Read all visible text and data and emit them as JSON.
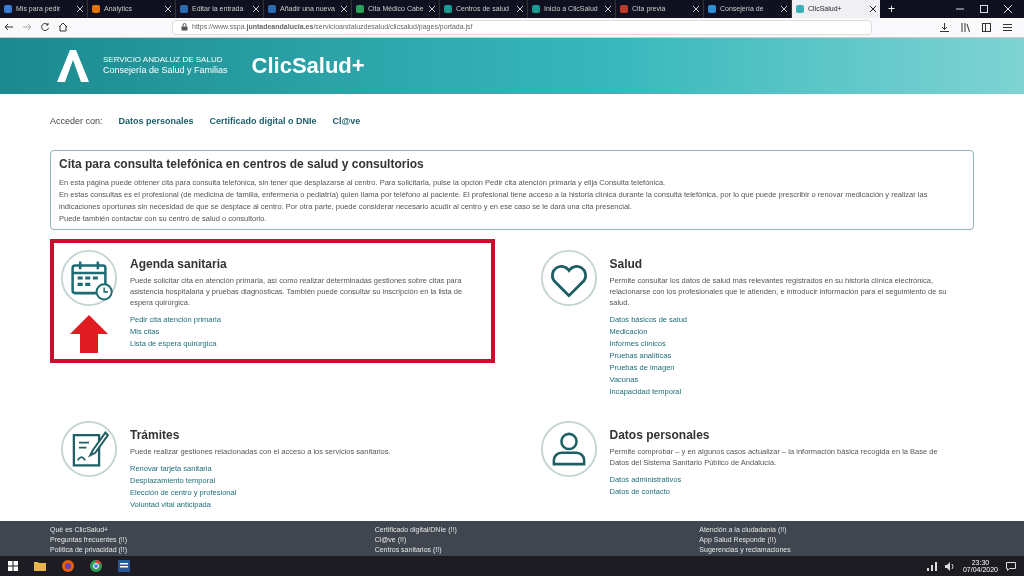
{
  "browser": {
    "tabs": [
      {
        "title": "Mis para pedir",
        "selected": false
      },
      {
        "title": "Analytics",
        "selected": false
      },
      {
        "title": "Editar la entrada",
        "selected": false
      },
      {
        "title": "Añadir una nueva",
        "selected": false
      },
      {
        "title": "Cita Médico Cabe",
        "selected": false
      },
      {
        "title": "Centros de salud",
        "selected": false
      },
      {
        "title": "Inicio a ClicSalud",
        "selected": false
      },
      {
        "title": "Cita previa",
        "selected": false
      },
      {
        "title": "Consejería de",
        "selected": false
      },
      {
        "title": "ClicSalud+",
        "selected": true
      }
    ],
    "new_tab": "+",
    "url": "https://www.sspa.**juntadeandalucia.es**/servicioandaluzdesalud/clicsalud/pages/portada.jsf"
  },
  "header": {
    "org_line_1": "SERVICIO ANDALUZ DE SALUD",
    "org_line_2": "Consejería de Salud y Familias",
    "brand": "ClicSalud+"
  },
  "access_bar": {
    "label": "Acceder con:",
    "options": [
      "Datos personales",
      "Certificado digital o DNIe",
      "Cl@ve"
    ]
  },
  "notice": {
    "title": "Cita para consulta telefónica en centros de salud y consultorios",
    "paragraphs": [
      "En esta página puede obtener cita para consulta telefónica, sin tener que desplazarse al centro. Para solicitarla, pulse la opción Pedir cita atención primaria y elija Consulta telefónica.",
      "En estas consultas es el profesional (de medicina de familia, enfermería o pediatría) quien llama por teléfono al paciente. El profesional tiene acceso a la historia clínica durante la consulta telefónica, por lo que puede prescribir o renovar medicación y realizar las indicaciones oportunas sin necesidad de que se desplace al centro. Por otra parte, puede considerar necesario acudir al centro y en ese caso se le dará una cita presencial.",
      "Puede también contactar con su centro de salud o consultorio."
    ]
  },
  "services": [
    {
      "kind": "calendar",
      "title": "Agenda sanitaria",
      "highlighted": true,
      "description": "Puede solicitar cita en atención primaria, así como realizar determinadas gestiones sobre citas para asistencia hospitalaria y pruebas diagnósticas. También puede consultar su inscripción en la lista de espera quirúrgica.",
      "links": [
        "Pedir cita atención primaria",
        "Mis citas",
        "Lista de espera quirúrgica"
      ]
    },
    {
      "kind": "heart",
      "title": "Salud",
      "highlighted": false,
      "description": "Permite consultar los datos de salud más relevantes registrados en su historia clínica electrónica, relacionarse con los profesionales que le atienden, e introducir información para el seguimiento de su salud.",
      "links": [
        "Datos básicos de salud",
        "Medicación",
        "Informes clínicos",
        "Pruebas analíticas",
        "Pruebas de imagen",
        "Vacunas",
        "Incapacidad temporal"
      ]
    },
    {
      "kind": "document",
      "title": "Trámites",
      "highlighted": false,
      "description": "Puede realizar gestiones relacionadas con el acceso a los servicios sanitarios.",
      "links": [
        "Renovar tarjeta sanitaria",
        "Desplazamiento temporal",
        "Elección de centro y profesional",
        "Voluntad vital anticipada"
      ]
    },
    {
      "kind": "person",
      "title": "Datos personales",
      "highlighted": false,
      "description": "Permite comprobar – y en algunos casos actualizar – la información básica recogida en la Base de Datos del Sistema Sanitario Público de Andalucía.",
      "links": [
        "Datos administrativos",
        "Datos de contacto"
      ]
    }
  ],
  "footer": {
    "columns": [
      [
        "Qué es ClicSalud+",
        "Preguntas frecuentes (!!)",
        "Política de privacidad (!!)"
      ],
      [
        "Certificado digital/DNIe (!!)",
        "Cl@ve (!!)",
        "Centros sanitarios (!!)"
      ],
      [
        "Atención a la ciudadanía (!!)",
        "App Salud Responde (!!)",
        "Sugerencias y reclamaciones"
      ]
    ]
  },
  "taskbar": {
    "time": "23:30",
    "date": "07/04/2020"
  }
}
